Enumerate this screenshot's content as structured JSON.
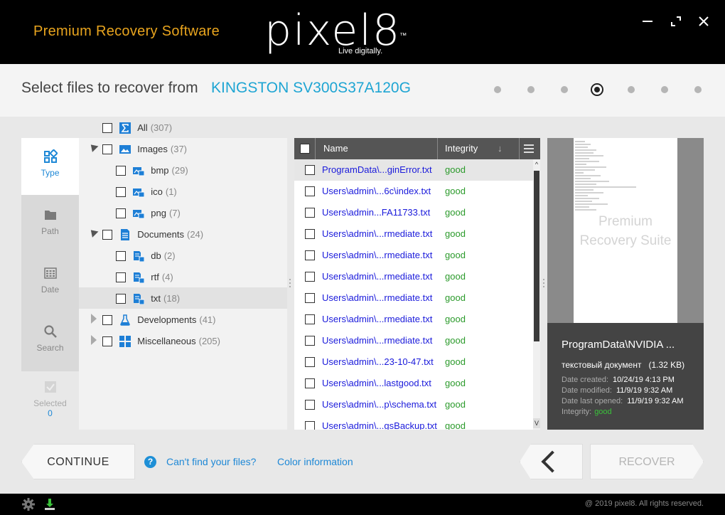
{
  "header": {
    "tagline": "Premium Recovery Software",
    "logo_text": "pixel8",
    "logo_tm": "™",
    "logo_subtitle": "Live digitally.",
    "colors": {
      "tagline": "#e8a41e",
      "accent": "#1ea5d3"
    }
  },
  "window_controls": {
    "minimize": "—",
    "maximize": "⤢",
    "close": "✕"
  },
  "title": {
    "label": "Select files to recover from",
    "drive": "KINGSTON SV300S37A120G",
    "steps_total": 7,
    "active_step": 4
  },
  "nav": {
    "items": [
      {
        "label": "Type",
        "icon": "type-icon"
      },
      {
        "label": "Path",
        "icon": "folder-icon"
      },
      {
        "label": "Date",
        "icon": "calendar-icon"
      },
      {
        "label": "Search",
        "icon": "search-icon"
      }
    ],
    "selected_label": "Selected",
    "selected_count": "0"
  },
  "tree": {
    "all": {
      "label": "All",
      "count": "(307)"
    },
    "images": {
      "label": "Images",
      "count": "(37)"
    },
    "bmp": {
      "label": "bmp",
      "count": "(29)"
    },
    "ico": {
      "label": "ico",
      "count": "(1)"
    },
    "png": {
      "label": "png",
      "count": "(7)"
    },
    "documents": {
      "label": "Documents",
      "count": "(24)"
    },
    "db": {
      "label": "db",
      "count": "(2)"
    },
    "rtf": {
      "label": "rtf",
      "count": "(4)"
    },
    "txt": {
      "label": "txt",
      "count": "(18)"
    },
    "developments": {
      "label": "Developments",
      "count": "(41)"
    },
    "misc": {
      "label": "Miscellaneous",
      "count": "(205)"
    }
  },
  "filelist": {
    "col_name": "Name",
    "col_integrity": "Integrity",
    "sort_arrow": "↓",
    "menu_glyph": "☰",
    "scroll_up": "^",
    "scroll_down": "V",
    "rows": [
      {
        "name": "ProgramData\\...ginError.txt",
        "integrity": "good"
      },
      {
        "name": "Users\\admin\\...6c\\index.txt",
        "integrity": "good"
      },
      {
        "name": "Users\\admin...FA11733.txt",
        "integrity": "good"
      },
      {
        "name": "Users\\admin\\...rmediate.txt",
        "integrity": "good"
      },
      {
        "name": "Users\\admin\\...rmediate.txt",
        "integrity": "good"
      },
      {
        "name": "Users\\admin\\...rmediate.txt",
        "integrity": "good"
      },
      {
        "name": "Users\\admin\\...rmediate.txt",
        "integrity": "good"
      },
      {
        "name": "Users\\admin\\...rmediate.txt",
        "integrity": "good"
      },
      {
        "name": "Users\\admin\\...rmediate.txt",
        "integrity": "good"
      },
      {
        "name": "Users\\admin\\...23-10-47.txt",
        "integrity": "good"
      },
      {
        "name": "Users\\admin\\...lastgood.txt",
        "integrity": "good"
      },
      {
        "name": "Users\\admin\\...p\\schema.txt",
        "integrity": "good"
      },
      {
        "name": "Users\\admin\\...gsBackup.txt",
        "integrity": "good"
      }
    ]
  },
  "preview": {
    "watermark_line1": "Premium",
    "watermark_line2": "Recovery Suite",
    "filename": "ProgramData\\NVIDIA ...",
    "type": "текстовый документ",
    "size": "(1.32 KB)",
    "created_label": "Date created:",
    "created": "10/24/19 4:13 PM",
    "modified_label": "Date modified:",
    "modified": "11/9/19 9:32 AM",
    "opened_label": "Date last opened:",
    "opened": "11/9/19 9:32 AM",
    "integrity_label": "Integrity:",
    "integrity": "good"
  },
  "bottom": {
    "continue_label": "CONTINUE",
    "help_glyph": "?",
    "cant_find": "Can't find your files?",
    "color_info": "Color information",
    "recover_label": "RECOVER"
  },
  "footer": {
    "copyright": "@ 2019 pixel8. All rights reserved.",
    "settings_icon": "gear-icon",
    "update_icon": "download-icon"
  }
}
